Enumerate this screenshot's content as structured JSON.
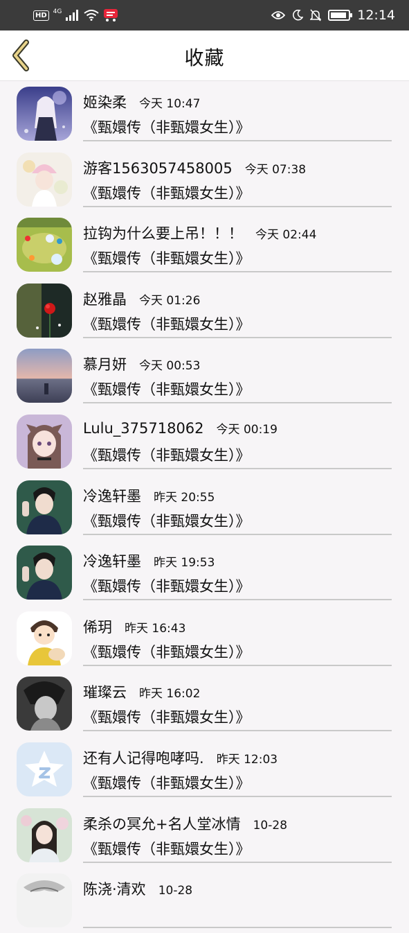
{
  "status_bar": {
    "hd": "HD",
    "network": "4G",
    "time": "12:14",
    "battery_level": 0.9,
    "icons": [
      "hd-icon",
      "signal-icon",
      "wifi-icon",
      "app-notification-icon",
      "eye-icon",
      "moon-icon",
      "bell-off-icon",
      "battery-icon"
    ]
  },
  "nav": {
    "title": "收藏",
    "back_icon": "chevron-left-icon",
    "accent_color": "#c9a72a"
  },
  "items": [
    {
      "name": "姬染柔",
      "time": "今天 10:47",
      "title": "《甄嬛传（非甄嬛女生）》",
      "avatar": "anime-girl-night"
    },
    {
      "name": "游客1563057458005",
      "time": "今天 07:38",
      "title": "《甄嬛传（非甄嬛女生）》",
      "avatar": "girl-pink-hat"
    },
    {
      "name": "拉钩为什么要上吊！！！",
      "time": "今天 02:44",
      "title": "《甄嬛传（非甄嬛女生）》",
      "avatar": "game-field"
    },
    {
      "name": "赵雅晶",
      "time": "今天 01:26",
      "title": "《甄嬛传（非甄嬛女生）》",
      "avatar": "red-rose"
    },
    {
      "name": "慕月妍",
      "time": "今天 00:53",
      "title": "《甄嬛传（非甄嬛女生）》",
      "avatar": "sunset-sea"
    },
    {
      "name": "Lulu_375718062",
      "time": "今天 00:19",
      "title": "《甄嬛传（非甄嬛女生）》",
      "avatar": "anime-girl-ears"
    },
    {
      "name": "冷逸轩墨",
      "time": "昨天 20:55",
      "title": "《甄嬛传（非甄嬛女生）》",
      "avatar": "actor-costume"
    },
    {
      "name": "冷逸轩墨",
      "time": "昨天 19:53",
      "title": "《甄嬛传（非甄嬛女生）》",
      "avatar": "actor-costume"
    },
    {
      "name": "俙玥",
      "time": "昨天 16:43",
      "title": "《甄嬛传（非甄嬛女生）》",
      "avatar": "cartoon-boy"
    },
    {
      "name": "璀璨云",
      "time": "昨天 16:02",
      "title": "《甄嬛传（非甄嬛女生）》",
      "avatar": "bw-portrait"
    },
    {
      "name": "还有人记得咆哮吗.",
      "time": "昨天 12:03",
      "title": "《甄嬛传（非甄嬛女生）》",
      "avatar": "qq-zone-star"
    },
    {
      "name": "柔杀の冥允+名人堂冰情",
      "time": "10-28",
      "title": "《甄嬛传（非甄嬛女生）》",
      "avatar": "woman-blossoms"
    },
    {
      "name": "陈浇·清欢",
      "time": "10-28",
      "title": "",
      "avatar": "sketch"
    }
  ]
}
